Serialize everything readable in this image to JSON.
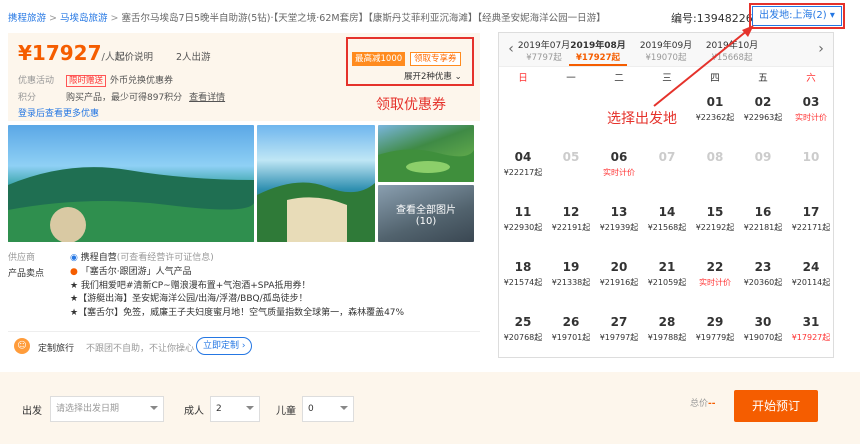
{
  "breadcrumb": [
    "携程旅游",
    "马埃岛旅游",
    "塞舌尔马埃岛7日5晚半自助游(5钻)·【天堂之境·62M套房】【康斯丹艾菲利亚沉海滩】【经典圣安妮海洋公园一日游】"
  ],
  "product_no": "编号:13948226",
  "departure_btn": "出发地:上海(2)",
  "price": {
    "amount": "¥17927",
    "unit": "/人起",
    "explain": "起价说明",
    "people": "2人出游"
  },
  "promo": {
    "label": "优惠活动",
    "tag": "限时赠送",
    "text": "外币兑换优惠券"
  },
  "points": {
    "label": "积分",
    "text": "购买产品，最少可得897积分",
    "link": "查看详情"
  },
  "login_hint": "登录后查看更多优惠",
  "coupons": {
    "max": "最高减1000",
    "claim": "领取专享券",
    "expand": "展开2种优惠"
  },
  "annotations": {
    "coupon": "领取优惠券",
    "departure": "选择出发地"
  },
  "photos": {
    "view_all": "查看全部图片",
    "count": "(10)"
  },
  "supplier": {
    "label": "供应商",
    "text": "携程自营",
    "sub": "(可查看经营许可证信息)"
  },
  "features": {
    "label": "产品卖点",
    "items": [
      "「塞舌尔·跟团游」人气产品",
      "★ 我们相爱吧#清新CP~赠浪漫布置+气泡酒+SPA抵用券！",
      "★【游艇出海】圣安妮海洋公园/出海/浮潜/BBQ/孤岛徒步！",
      "★【塞舌尔】免签，威廉王子夫妇度蜜月地！空气质量指数全球第一，森林覆盖47%"
    ]
  },
  "custom": {
    "title": "定制旅行",
    "text": "不跟团不自助，不让你操心",
    "btn": "立即定制"
  },
  "calendar": {
    "months": [
      {
        "label": "2019年07月",
        "price": "¥7797起"
      },
      {
        "label": "2019年08月",
        "price": "¥17927起"
      },
      {
        "label": "2019年09月",
        "price": "¥19070起"
      },
      {
        "label": "2019年10月",
        "price": "¥15668起"
      }
    ],
    "weekdays": [
      "日",
      "一",
      "二",
      "三",
      "四",
      "五",
      "六"
    ],
    "cells": [
      {
        "d": "",
        "p": ""
      },
      {
        "d": "",
        "p": ""
      },
      {
        "d": "",
        "p": ""
      },
      {
        "d": "",
        "p": ""
      },
      {
        "d": "01",
        "p": "¥22362起"
      },
      {
        "d": "02",
        "p": "¥22963起"
      },
      {
        "d": "03",
        "p": "实时计价",
        "red": true
      },
      {
        "d": "04",
        "p": "¥22217起"
      },
      {
        "d": "05",
        "p": "",
        "off": true
      },
      {
        "d": "06",
        "p": "实时计价",
        "red": true
      },
      {
        "d": "07",
        "p": "",
        "off": true
      },
      {
        "d": "08",
        "p": "",
        "off": true
      },
      {
        "d": "09",
        "p": "",
        "off": true
      },
      {
        "d": "10",
        "p": "",
        "off": true
      },
      {
        "d": "11",
        "p": "¥22930起"
      },
      {
        "d": "12",
        "p": "¥22191起"
      },
      {
        "d": "13",
        "p": "¥21939起"
      },
      {
        "d": "14",
        "p": "¥21568起"
      },
      {
        "d": "15",
        "p": "¥22192起"
      },
      {
        "d": "16",
        "p": "¥22181起"
      },
      {
        "d": "17",
        "p": "¥22171起"
      },
      {
        "d": "18",
        "p": "¥21574起"
      },
      {
        "d": "19",
        "p": "¥21338起"
      },
      {
        "d": "20",
        "p": "¥21916起"
      },
      {
        "d": "21",
        "p": "¥21059起"
      },
      {
        "d": "22",
        "p": "实时计价",
        "red": true
      },
      {
        "d": "23",
        "p": "¥20360起"
      },
      {
        "d": "24",
        "p": "¥20114起"
      },
      {
        "d": "25",
        "p": "¥20768起"
      },
      {
        "d": "26",
        "p": "¥19701起"
      },
      {
        "d": "27",
        "p": "¥19797起"
      },
      {
        "d": "28",
        "p": "¥19788起"
      },
      {
        "d": "29",
        "p": "¥19779起"
      },
      {
        "d": "30",
        "p": "¥19070起"
      },
      {
        "d": "31",
        "p": "¥17927起",
        "red": true
      }
    ]
  },
  "booking": {
    "depart_label": "出发",
    "depart_placeholder": "请选择出发日期",
    "adult_label": "成人",
    "adult_value": "2",
    "child_label": "儿童",
    "child_value": "0",
    "total_label": "总价",
    "total_value": "--",
    "book_btn": "开始预订"
  }
}
